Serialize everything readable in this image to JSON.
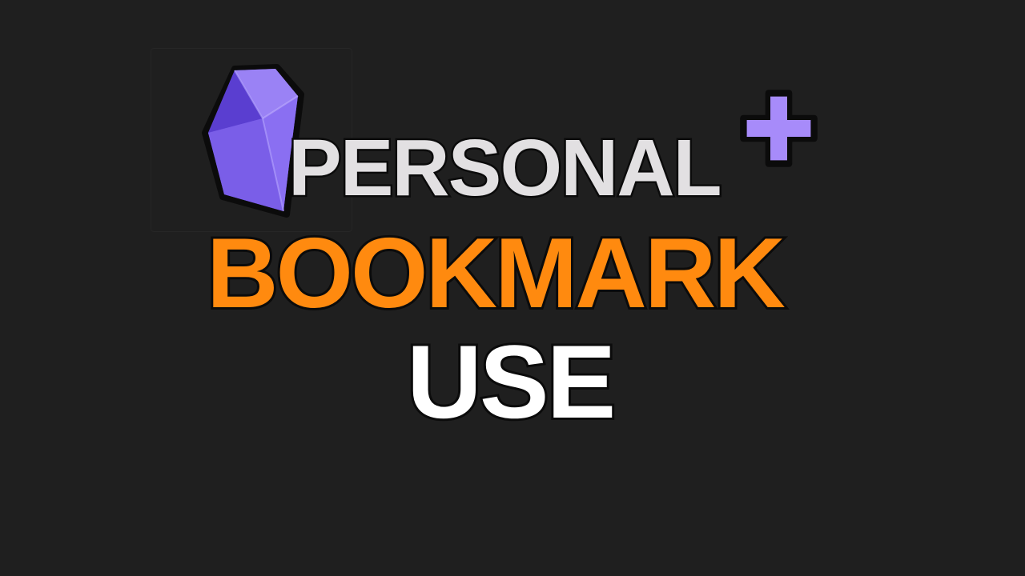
{
  "headline": {
    "line1": "PERSONAL",
    "line2": "BOOKMARK",
    "line3": "USE"
  },
  "icons": {
    "logo": "obsidian-crystal-icon",
    "badge": "plus-icon"
  },
  "colors": {
    "background": "#1f1f1f",
    "line1": "#e2e0e2",
    "line2": "#ff8a0f",
    "line3": "#ffffff",
    "crystal": "#7b5cf0",
    "plus": "#a78bfa",
    "outline": "#0b0b0b"
  }
}
